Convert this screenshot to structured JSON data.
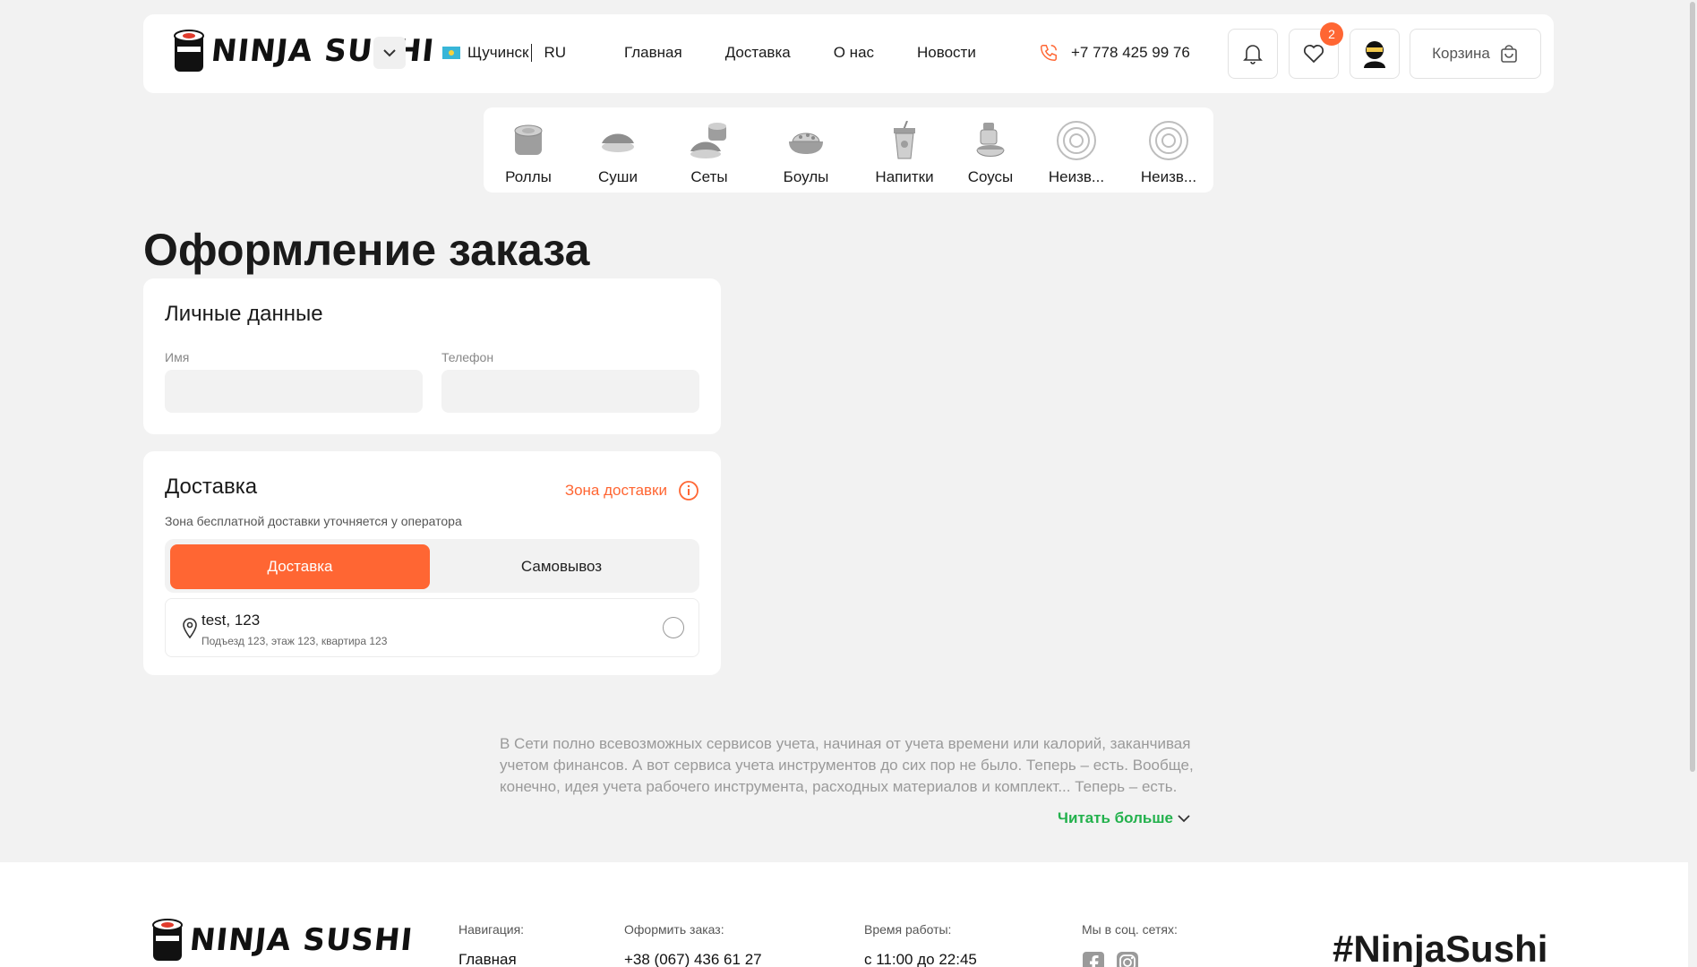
{
  "header": {
    "logo_text": "NINJA SUSHI",
    "city": "Щучинск",
    "lang": "RU",
    "nav": [
      "Главная",
      "Доставка",
      "О нас",
      "Новости"
    ],
    "phone": "+7 778 425 99 76",
    "favorites_count": "2",
    "cart_label": "Корзина"
  },
  "categories": [
    {
      "label": "Роллы",
      "icon": "roll-icon"
    },
    {
      "label": "Суши",
      "icon": "sushi-icon"
    },
    {
      "label": "Сеты",
      "icon": "set-icon"
    },
    {
      "label": "Боулы",
      "icon": "bowl-icon"
    },
    {
      "label": "Напитки",
      "icon": "drink-icon"
    },
    {
      "label": "Соусы",
      "icon": "sauce-icon"
    },
    {
      "label": "Неизв...",
      "icon": "unknown-icon"
    },
    {
      "label": "Неизв...",
      "icon": "unknown-icon"
    }
  ],
  "page_title": "Оформление заказа",
  "personal": {
    "title": "Личные данные",
    "name_label": "Имя",
    "name_value": "",
    "phone_label": "Телефон",
    "phone_value": ""
  },
  "delivery": {
    "title": "Доставка",
    "zone_link": "Зона доставки",
    "hint": "Зона бесплатной доставки уточняется у оператора",
    "option_delivery": "Доставка",
    "option_pickup": "Самовывоз",
    "address_line1": "test, 123",
    "address_line2": "Подъезд 123, этаж 123, квартира 123"
  },
  "seo": {
    "text": "В Сети полно всевозможных сервисов учета, начиная от учета времени или калорий, заканчивая учетом финансов. А вот сервиса учета инструментов до сих пор не было. Теперь – есть. Вообще, конечно, идея учета рабочего инструмента, расходных материалов и комплект... Теперь – есть.",
    "read_more": "Читать больше"
  },
  "footer": {
    "logo_text": "NINJA SUSHI",
    "nav_heading": "Навигация:",
    "nav_first": "Главная",
    "order_heading": "Оформить заказ:",
    "order_phone": "+38 (067) 436 61 27",
    "hours_heading": "Время работы:",
    "hours_value": "с 11:00 до 22:45",
    "social_heading": "Мы в соц. сетях:",
    "hashtag": "#NinjaSushi"
  },
  "colors": {
    "accent": "#ff6633",
    "link_green": "#22b14c",
    "background": "#f2f2f2"
  }
}
